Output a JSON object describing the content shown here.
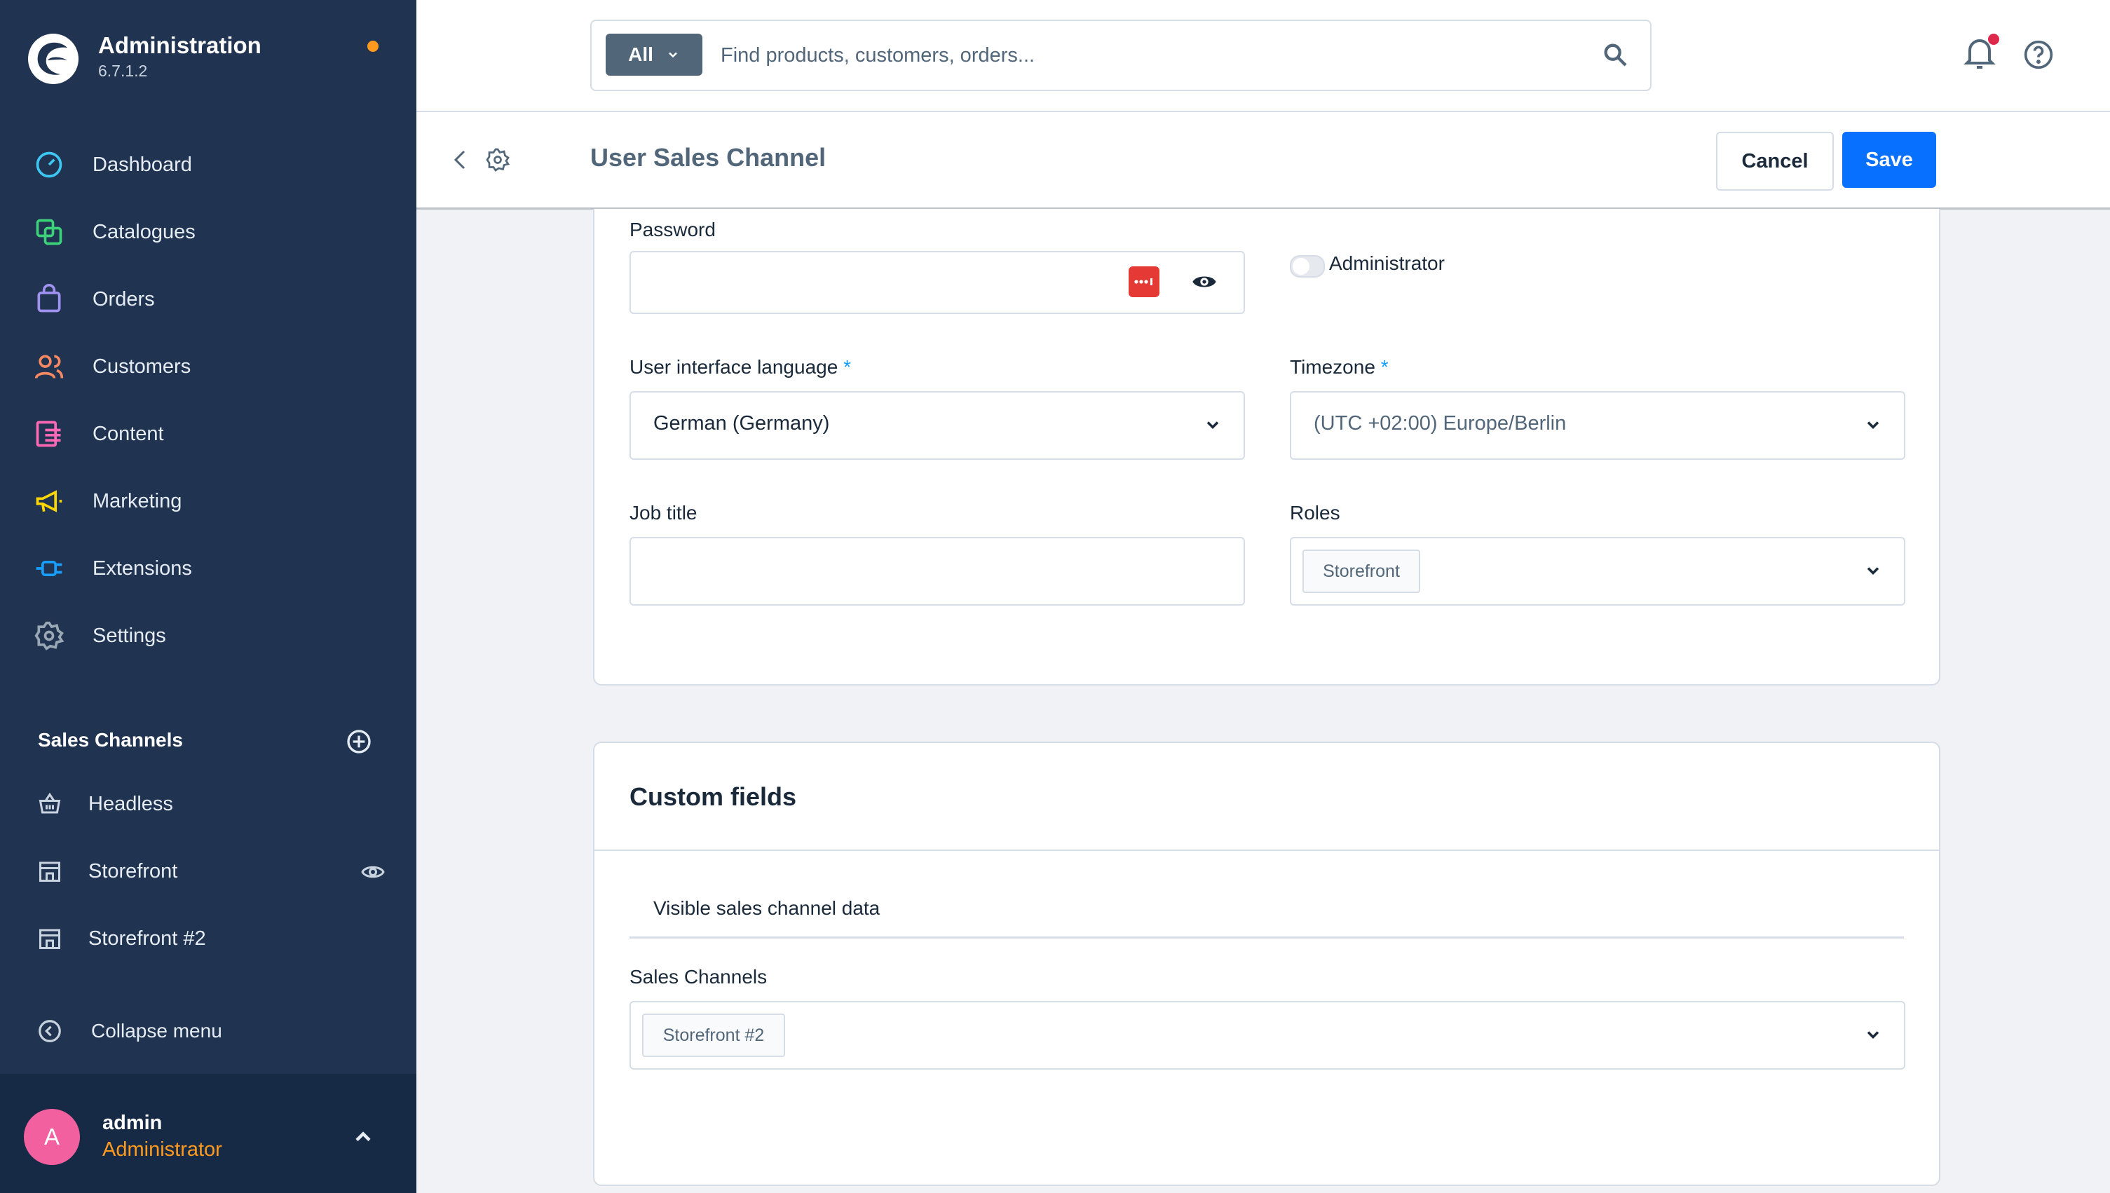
{
  "app": {
    "title": "Administration",
    "version": "6.7.1.2"
  },
  "nav": {
    "items": [
      {
        "label": "Dashboard",
        "icon": "dashboard-icon"
      },
      {
        "label": "Catalogues",
        "icon": "catalogues-icon"
      },
      {
        "label": "Orders",
        "icon": "orders-icon"
      },
      {
        "label": "Customers",
        "icon": "customers-icon"
      },
      {
        "label": "Content",
        "icon": "content-icon"
      },
      {
        "label": "Marketing",
        "icon": "marketing-icon"
      },
      {
        "label": "Extensions",
        "icon": "extensions-icon"
      },
      {
        "label": "Settings",
        "icon": "settings-icon"
      }
    ]
  },
  "sales_channels": {
    "header": "Sales Channels",
    "items": [
      {
        "label": "Headless",
        "icon": "basket-icon"
      },
      {
        "label": "Storefront",
        "icon": "storefront-icon"
      },
      {
        "label": "Storefront #2",
        "icon": "storefront-icon"
      }
    ]
  },
  "collapse_label": "Collapse menu",
  "user": {
    "initial": "A",
    "name": "admin",
    "role": "Administrator"
  },
  "search": {
    "type_label": "All",
    "placeholder": "Find products, customers, orders..."
  },
  "smartbar": {
    "title": "User Sales Channel",
    "cancel": "Cancel",
    "save": "Save"
  },
  "form": {
    "password_label": "Password",
    "password_value": "",
    "admin_toggle_label": "Administrator",
    "language_label": "User interface language",
    "language_required": "*",
    "language_value": "German (Germany)",
    "timezone_label": "Timezone",
    "timezone_required": "*",
    "timezone_value": "(UTC +02:00) Europe/Berlin",
    "job_title_label": "Job title",
    "job_title_value": "",
    "roles_label": "Roles",
    "roles_tags": [
      "Storefront"
    ]
  },
  "custom_fields": {
    "title": "Custom fields",
    "tab": "Visible sales channel data",
    "sales_channels_label": "Sales Channels",
    "sales_channels_tags": [
      "Storefront #2"
    ]
  },
  "colors": {
    "sidebar_bg": "#203350",
    "accent": "#0870ff",
    "notification": "#de294c",
    "status_dot": "#ff9a1f",
    "avatar": "#f3609f"
  }
}
